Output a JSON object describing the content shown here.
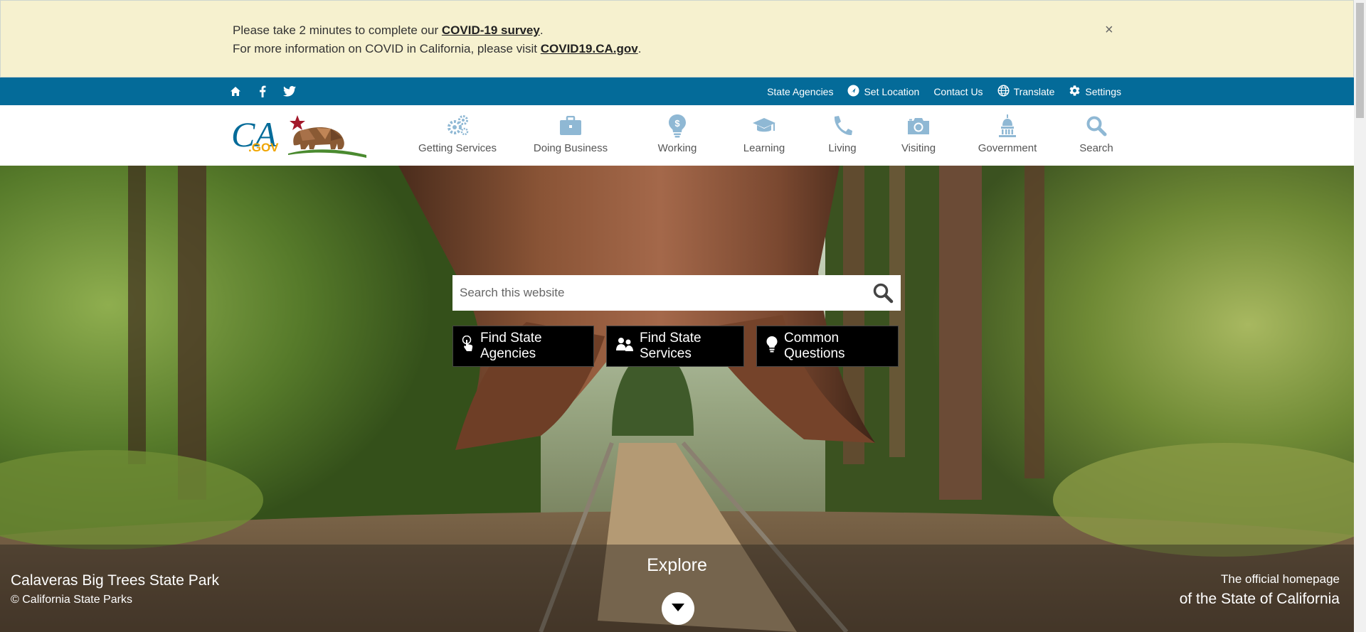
{
  "alert": {
    "line1_prefix": "Please take 2 minutes to complete our ",
    "line1_link": "COVID-19 survey",
    "line1_suffix": ".",
    "line2_prefix": "For more information on COVID in California, please visit ",
    "line2_link": "COVID19.CA.gov",
    "line2_suffix": ".",
    "close": "×"
  },
  "utility": {
    "left_icons": [
      "home-icon",
      "facebook-icon",
      "twitter-icon"
    ],
    "links": {
      "state_agencies": "State Agencies",
      "set_location": "Set Location",
      "contact_us": "Contact Us",
      "translate": "Translate",
      "settings": "Settings"
    }
  },
  "logo": {
    "text": "CA",
    "subtext": ".GOV"
  },
  "nav": {
    "items": [
      {
        "label": "Getting Services",
        "icon": "gears-icon"
      },
      {
        "label": "Doing Business",
        "icon": "briefcase-icon"
      },
      {
        "label": "Working",
        "icon": "lightbulb-dollar-icon"
      },
      {
        "label": "Learning",
        "icon": "graduation-cap-icon"
      },
      {
        "label": "Living",
        "icon": "phone-icon"
      },
      {
        "label": "Visiting",
        "icon": "camera-icon"
      },
      {
        "label": "Government",
        "icon": "capitol-icon"
      },
      {
        "label": "Search",
        "icon": "search-icon"
      }
    ]
  },
  "hero": {
    "search_placeholder": "Search this website",
    "buttons": {
      "agencies": "Find State Agencies",
      "services": "Find State Services",
      "questions": "Common Questions"
    },
    "explore": "Explore",
    "caption_title": "Calaveras Big Trees State Park",
    "caption_credit": "© California State Parks",
    "official_line1": "The official homepage",
    "official_line2": "of the State of California"
  },
  "colors": {
    "alert_bg": "#f6f1cf",
    "utility_bg": "#046b99",
    "nav_icon": "#8fb8d4",
    "button_bg": "#000000",
    "star": "#a3192b"
  }
}
